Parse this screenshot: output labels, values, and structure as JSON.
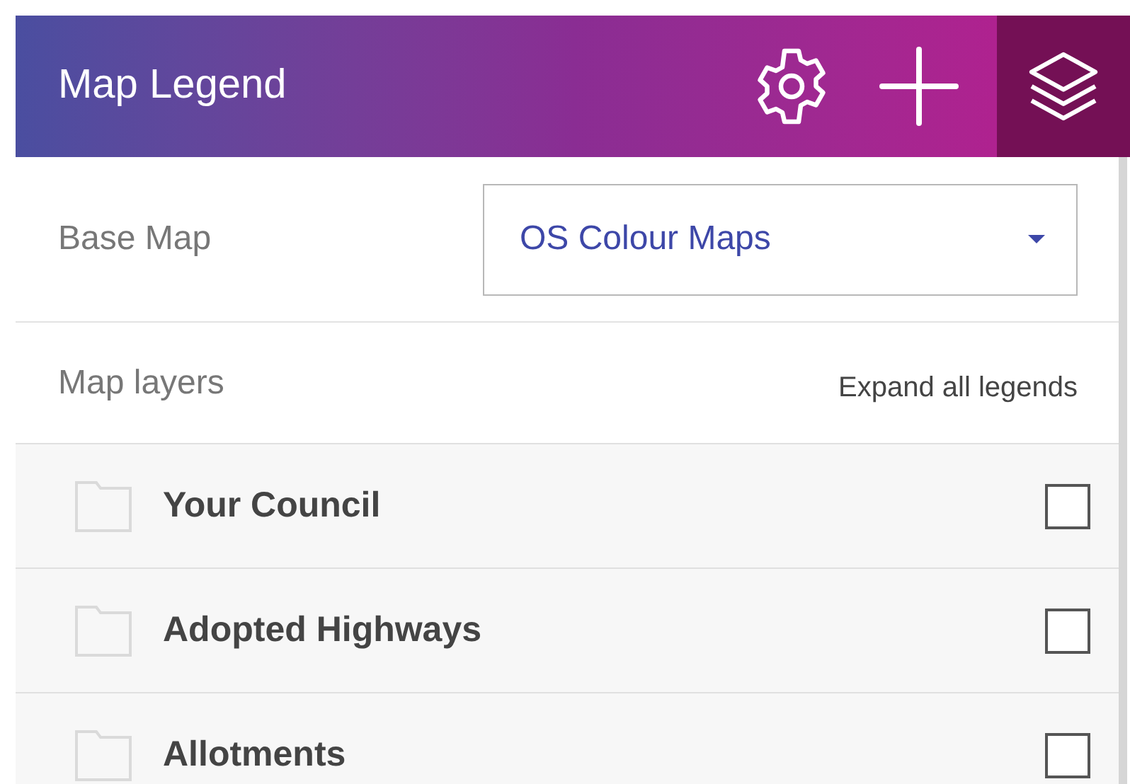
{
  "header": {
    "title": "Map Legend"
  },
  "base_map": {
    "label": "Base Map",
    "value": "OS Colour Maps"
  },
  "layers_heading": {
    "label": "Map layers",
    "expand_link": "Expand all legends"
  },
  "layers": [
    {
      "name": "Your Council",
      "checked": false
    },
    {
      "name": "Adopted Highways",
      "checked": false
    },
    {
      "name": "Allotments",
      "checked": false
    }
  ]
}
